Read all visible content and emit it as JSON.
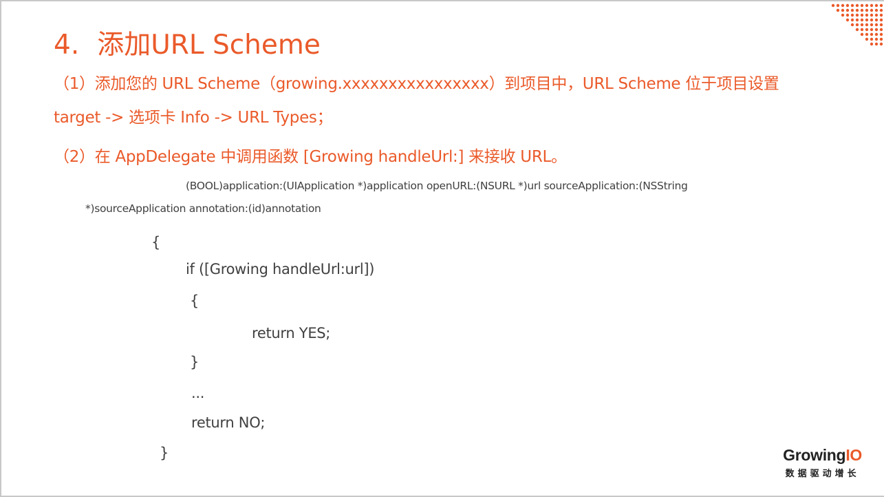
{
  "slide": {
    "title_num": "4.",
    "title_text": "添加URL Scheme",
    "para1_line1": "（1）添加您的 URL Scheme（growing.xxxxxxxxxxxxxxxx）到项目中，URL Scheme 位于项目设置",
    "para1_line2": "target -> 选项卡 Info -> URL Types；",
    "para2": "（2）在 AppDelegate 中调用函数 [Growing handleUrl:] 来接收 URL。"
  },
  "code": {
    "line1": "(BOOL)application:(UIApplication *)application openURL:(NSURL *)url sourceApplication:(NSString",
    "line2": "*)sourceApplication annotation:(id)annotation",
    "line3": "{",
    "line4": "if ([Growing handleUrl:url])",
    "line5": "{",
    "line6": "return YES;",
    "line7": "}",
    "line8": "...",
    "line9": "return NO;",
    "line10": "}"
  },
  "logo": {
    "brand_main": "Growing",
    "brand_io": "IO",
    "tagline": "数据驱动增长"
  },
  "colors": {
    "accent": "#ea5a2a",
    "code_text": "#404040"
  },
  "icons": {
    "corner": "dot-grid-decoration"
  }
}
